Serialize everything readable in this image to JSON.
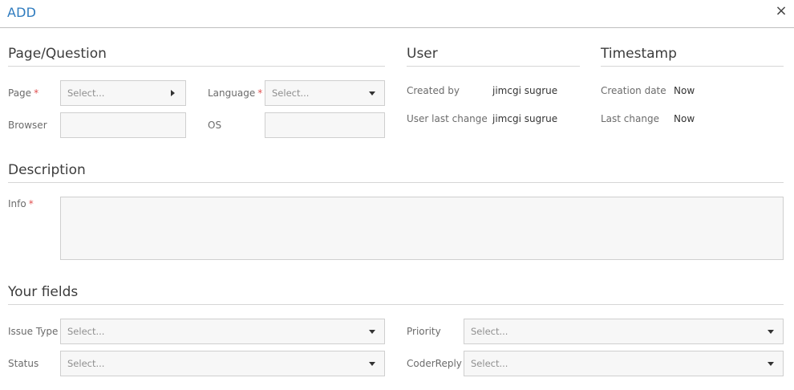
{
  "header": {
    "title": "ADD",
    "close_icon": "×"
  },
  "page_question": {
    "title": "Page/Question",
    "page_label": "Page",
    "page_placeholder": "Select...",
    "language_label": "Language",
    "language_placeholder": "Select...",
    "browser_label": "Browser",
    "browser_value": "",
    "os_label": "OS",
    "os_value": "",
    "required_mark": "*"
  },
  "user": {
    "title": "User",
    "created_by_label": "Created by",
    "created_by_value": "jimcgi sugrue",
    "last_change_label": "User last change",
    "last_change_value": "jimcgi sugrue"
  },
  "timestamp": {
    "title": "Timestamp",
    "creation_label": "Creation date",
    "creation_value": "Now",
    "last_change_label": "Last change",
    "last_change_value": "Now"
  },
  "description": {
    "title": "Description",
    "info_label": "Info",
    "info_value": ""
  },
  "your_fields": {
    "title": "Your fields",
    "issue_type_label": "Issue Type",
    "issue_type_placeholder": "Select...",
    "priority_label": "Priority",
    "priority_placeholder": "Select...",
    "status_label": "Status",
    "status_placeholder": "Select...",
    "coder_reply_label": "CoderReply",
    "coder_reply_placeholder": "Select..."
  },
  "colors": {
    "accent": "#2e7bbf",
    "required": "#e05050",
    "field_bg": "#f7f7f7"
  }
}
